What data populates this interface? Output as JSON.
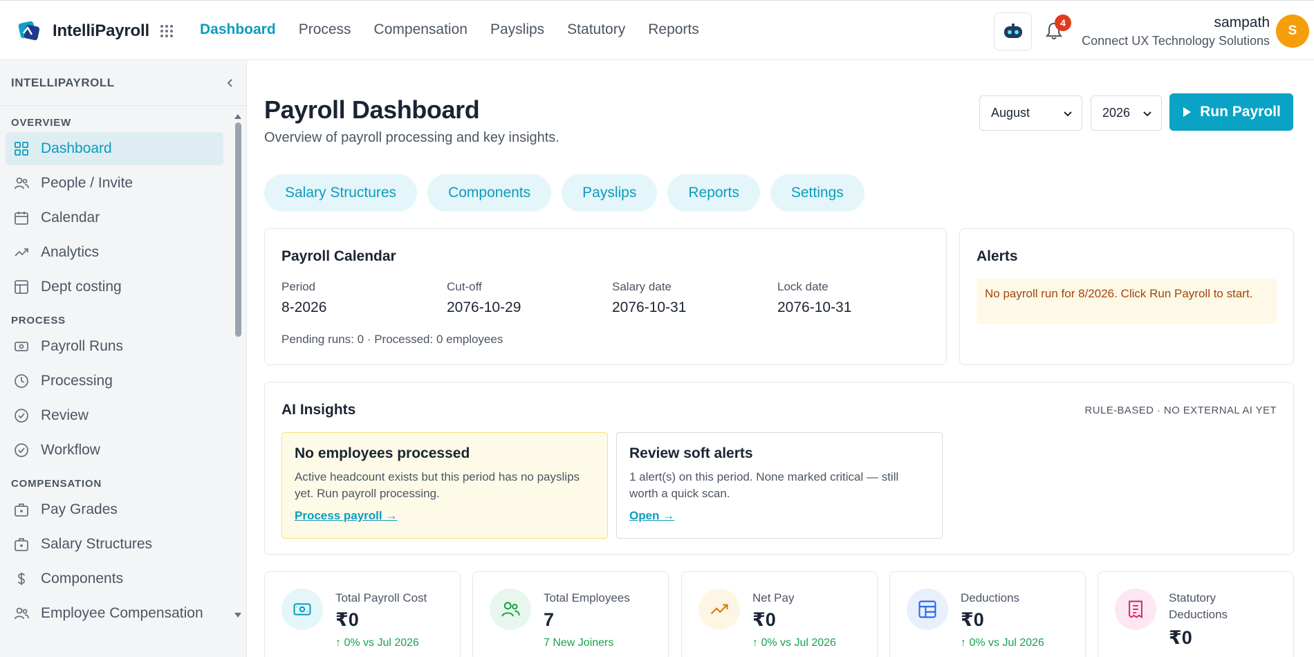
{
  "app": {
    "name": "IntelliPayroll"
  },
  "topnav": {
    "items": [
      {
        "label": "Dashboard",
        "active": true
      },
      {
        "label": "Process"
      },
      {
        "label": "Compensation"
      },
      {
        "label": "Payslips"
      },
      {
        "label": "Statutory"
      },
      {
        "label": "Reports"
      }
    ]
  },
  "notifications": {
    "count": "4"
  },
  "user": {
    "name": "sampath",
    "org": "Connect UX Technology Solutions",
    "initial": "S"
  },
  "sidebar": {
    "title": "INTELLIPAYROLL",
    "sections": [
      {
        "title": "OVERVIEW",
        "items": [
          {
            "label": "Dashboard",
            "icon": "grid-icon",
            "active": true
          },
          {
            "label": "People / Invite",
            "icon": "people-icon"
          },
          {
            "label": "Calendar",
            "icon": "calendar-icon"
          },
          {
            "label": "Analytics",
            "icon": "trend-icon"
          },
          {
            "label": "Dept costing",
            "icon": "table-icon"
          }
        ]
      },
      {
        "title": "PROCESS",
        "items": [
          {
            "label": "Payroll Runs",
            "icon": "cash-icon"
          },
          {
            "label": "Processing",
            "icon": "clock-icon"
          },
          {
            "label": "Review",
            "icon": "check-circle-icon"
          },
          {
            "label": "Workflow",
            "icon": "check-circle-icon"
          }
        ]
      },
      {
        "title": "COMPENSATION",
        "items": [
          {
            "label": "Pay Grades",
            "icon": "briefcase-icon"
          },
          {
            "label": "Salary Structures",
            "icon": "briefcase-icon"
          },
          {
            "label": "Components",
            "icon": "dollar-icon"
          },
          {
            "label": "Employee Compensation",
            "icon": "people-icon"
          }
        ]
      }
    ]
  },
  "page": {
    "title": "Payroll Dashboard",
    "subtitle": "Overview of payroll processing and key insights.",
    "month": "August",
    "year": "2026",
    "run_label": "Run Payroll"
  },
  "chips": [
    "Salary Structures",
    "Components",
    "Payslips",
    "Reports",
    "Settings"
  ],
  "calendar": {
    "title": "Payroll Calendar",
    "fields": [
      {
        "label": "Period",
        "value": "8-2026"
      },
      {
        "label": "Cut-off",
        "value": "2076-10-29"
      },
      {
        "label": "Salary date",
        "value": "2076-10-31"
      },
      {
        "label": "Lock date",
        "value": "2076-10-31"
      }
    ],
    "footer": "Pending runs: 0 · Processed: 0 employees"
  },
  "alerts": {
    "title": "Alerts",
    "message": "No payroll run for 8/2026. Click Run Payroll to start."
  },
  "ai": {
    "title": "AI Insights",
    "tag": "RULE-BASED · NO EXTERNAL AI YET",
    "cards": [
      {
        "heading": "No employees processed",
        "text": "Active headcount exists but this period has no payslips yet. Run payroll processing.",
        "link": "Process payroll →"
      },
      {
        "heading": "Review soft alerts",
        "text": "1 alert(s) on this period. None marked critical — still worth a quick scan.",
        "link": "Open →"
      }
    ]
  },
  "stats": [
    {
      "label": "Total Payroll Cost",
      "value": "₹0",
      "delta": "↑ 0% vs Jul 2026",
      "icon": "cash-icon",
      "color": "#0a9cbf",
      "bg": "#e4f6f9"
    },
    {
      "label": "Total Employees",
      "value": "7",
      "delta": "7 New Joiners",
      "icon": "people-icon",
      "color": "#16a34a",
      "bg": "#e7f7ee"
    },
    {
      "label": "Net Pay",
      "value": "₹0",
      "delta": "↑ 0% vs Jul 2026",
      "icon": "trend-icon",
      "color": "#d97706",
      "bg": "#fef6e4"
    },
    {
      "label": "Deductions",
      "value": "₹0",
      "delta": "↑ 0% vs Jul 2026",
      "icon": "table-icon",
      "color": "#2563eb",
      "bg": "#e8f0fe"
    },
    {
      "label": "Statutory Deductions",
      "value": "₹0",
      "delta": "",
      "icon": "receipt-icon",
      "color": "#db2777",
      "bg": "#fde8f1"
    }
  ]
}
